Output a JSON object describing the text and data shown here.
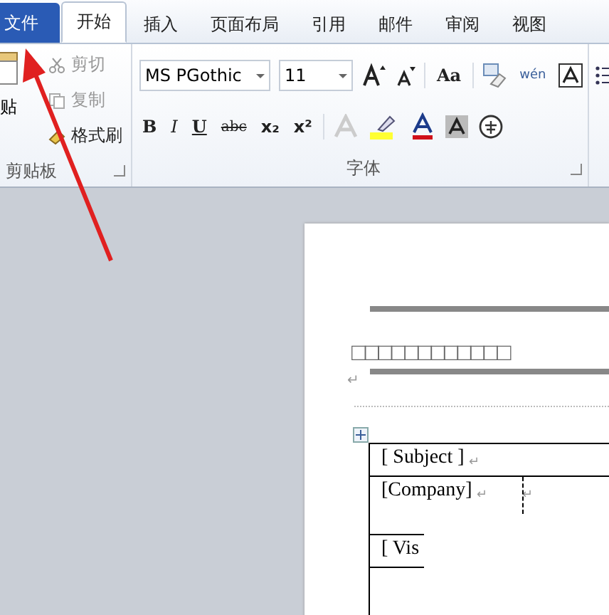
{
  "tabs": [
    {
      "label": "文件",
      "kind": "file",
      "selected": false
    },
    {
      "label": "开始",
      "kind": "tab",
      "selected": true
    },
    {
      "label": "插入",
      "kind": "tab",
      "selected": false
    },
    {
      "label": "页面布局",
      "kind": "tab",
      "selected": false
    },
    {
      "label": "引用",
      "kind": "tab",
      "selected": false
    },
    {
      "label": "邮件",
      "kind": "tab",
      "selected": false
    },
    {
      "label": "审阅",
      "kind": "tab",
      "selected": false
    },
    {
      "label": "视图",
      "kind": "tab",
      "selected": false
    }
  ],
  "clipboard": {
    "paste_label": "贴",
    "group_label": "剪贴板",
    "items": [
      {
        "label": "剪切",
        "kind": "cut",
        "disabled": true
      },
      {
        "label": "复制",
        "kind": "copy",
        "disabled": true
      },
      {
        "label": "格式刷",
        "kind": "painter",
        "disabled": false
      }
    ]
  },
  "font": {
    "group_label": "字体",
    "font_name": "MS PGothic",
    "font_size": "11",
    "case_label": "Aa",
    "phonetic_label": "wén",
    "row2": [
      {
        "label": "B",
        "kind": "bold"
      },
      {
        "label": "I",
        "kind": "italic"
      },
      {
        "label": "U",
        "kind": "underline"
      },
      {
        "label": "abc",
        "kind": "strike"
      },
      {
        "label": "x₂",
        "kind": "sub"
      },
      {
        "label": "x²",
        "kind": "sup"
      }
    ]
  },
  "document": {
    "title_boxes": "□□□□□□□□□□□□",
    "paragraph_mark": "↵",
    "table": [
      {
        "text": "[ Subject ]",
        "mark": "↵"
      },
      {
        "text": "[Company]",
        "mark": "↵"
      },
      {
        "text": "[ Vis"
      }
    ]
  }
}
